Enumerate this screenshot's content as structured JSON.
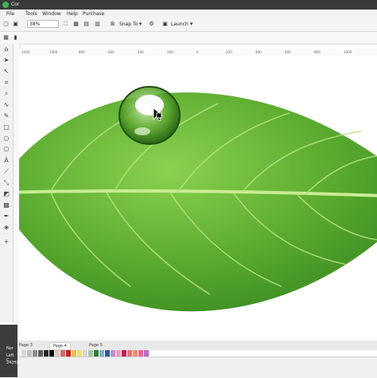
{
  "window": {
    "title": "Cor"
  },
  "menu": {
    "items": [
      "File",
      "Tools",
      "Window",
      "Help",
      "Purchase"
    ]
  },
  "toolbar": {
    "zoom": "38%",
    "snap_label": "Snap To",
    "launch_label": "Launch"
  },
  "ruler": {
    "ticks": [
      "1200",
      "1000",
      "800",
      "600",
      "400",
      "200",
      "0",
      "200",
      "400",
      "600",
      "800",
      "1000"
    ]
  },
  "pages": [
    "Page 3",
    "Page 4",
    "Page 5"
  ],
  "active_page": "Page 4",
  "status": {
    "line1": "Nor",
    "line2": "Left C",
    "line3": "24(H)"
  },
  "palette": [
    "#f2f2f2",
    "#d9d9d9",
    "#bfbfbf",
    "#8c8c8c",
    "#595959",
    "#262626",
    "#000000",
    "#e3c1c1",
    "#cf6b6b",
    "#c81e1e",
    "#e8c44a",
    "#f2e06b",
    "#d7d7d7",
    "#a8c4a6",
    "#2e7d32",
    "#7bb0d6",
    "#2b5a9e",
    "#c08fcf",
    "#e7a1b7",
    "#c2185b",
    "#e57373",
    "#ff8a65",
    "#f06292",
    "#ba68c8"
  ],
  "colors": {
    "accent": "#3bb54a",
    "leaf_dark": "#2f8a23",
    "leaf_light": "#8bd14f"
  }
}
